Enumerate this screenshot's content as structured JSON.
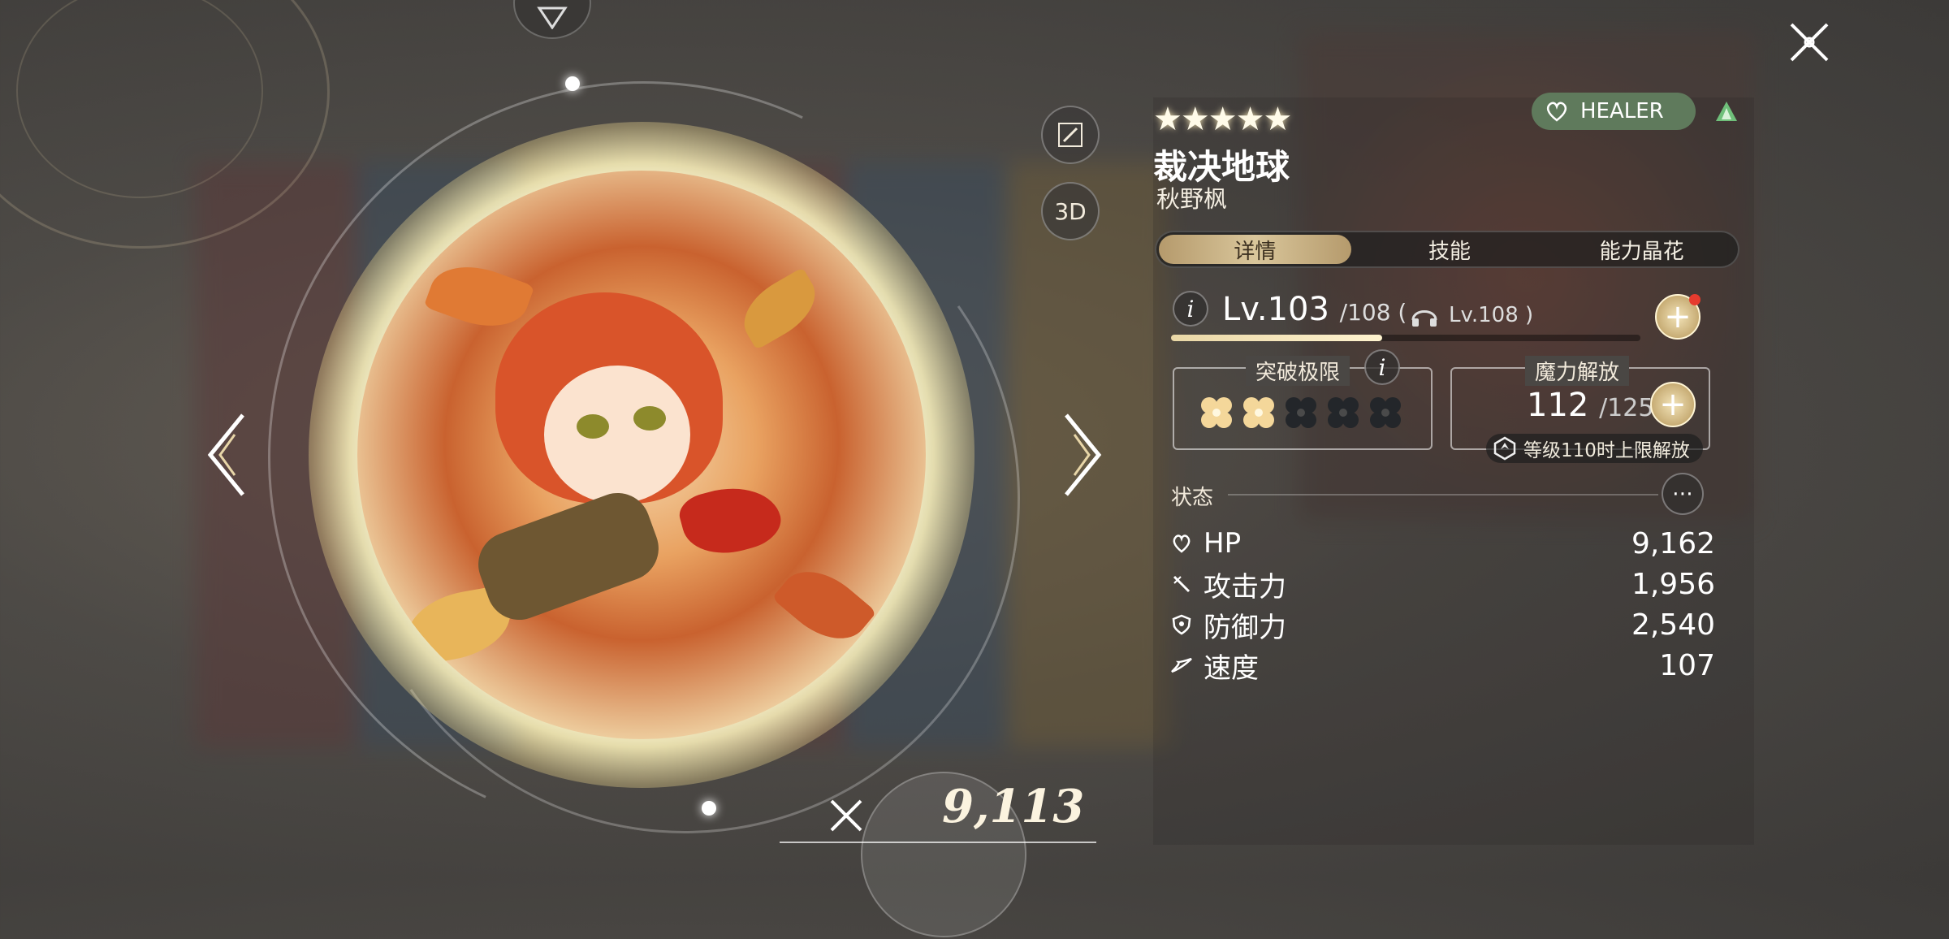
{
  "character": {
    "rarity_stars": "★★★★★",
    "title": "裁决地球",
    "name": "秋野枫",
    "role": "HEALER"
  },
  "tabs": [
    "详情",
    "技能",
    "能力晶花"
  ],
  "level": {
    "prefix": "Lv.",
    "current": "103",
    "max_text": "/108 (",
    "cap_text": "Lv.108 )",
    "progress": 0.45
  },
  "limit_break": {
    "title": "突破极限",
    "filled": 2,
    "total": 5
  },
  "mana_release": {
    "title": "魔力解放",
    "current": "112",
    "max_text": "/125",
    "note": "等级110时上限解放"
  },
  "status": {
    "title": "状态",
    "stats": [
      {
        "icon": "heart-icon",
        "label": "HP",
        "value": "9,162"
      },
      {
        "icon": "sword-icon",
        "label": "攻击力",
        "value": "1,956"
      },
      {
        "icon": "shield-icon",
        "label": "防御力",
        "value": "2,540"
      },
      {
        "icon": "wing-icon",
        "label": "速度",
        "value": "107"
      }
    ]
  },
  "side_buttons": {
    "three_d": "3D"
  },
  "power": {
    "value": "9,113"
  },
  "colors": {
    "role_badge": "#5f7a5c",
    "accent_gold": "#d9c69b",
    "notification": "#e63b2e"
  }
}
